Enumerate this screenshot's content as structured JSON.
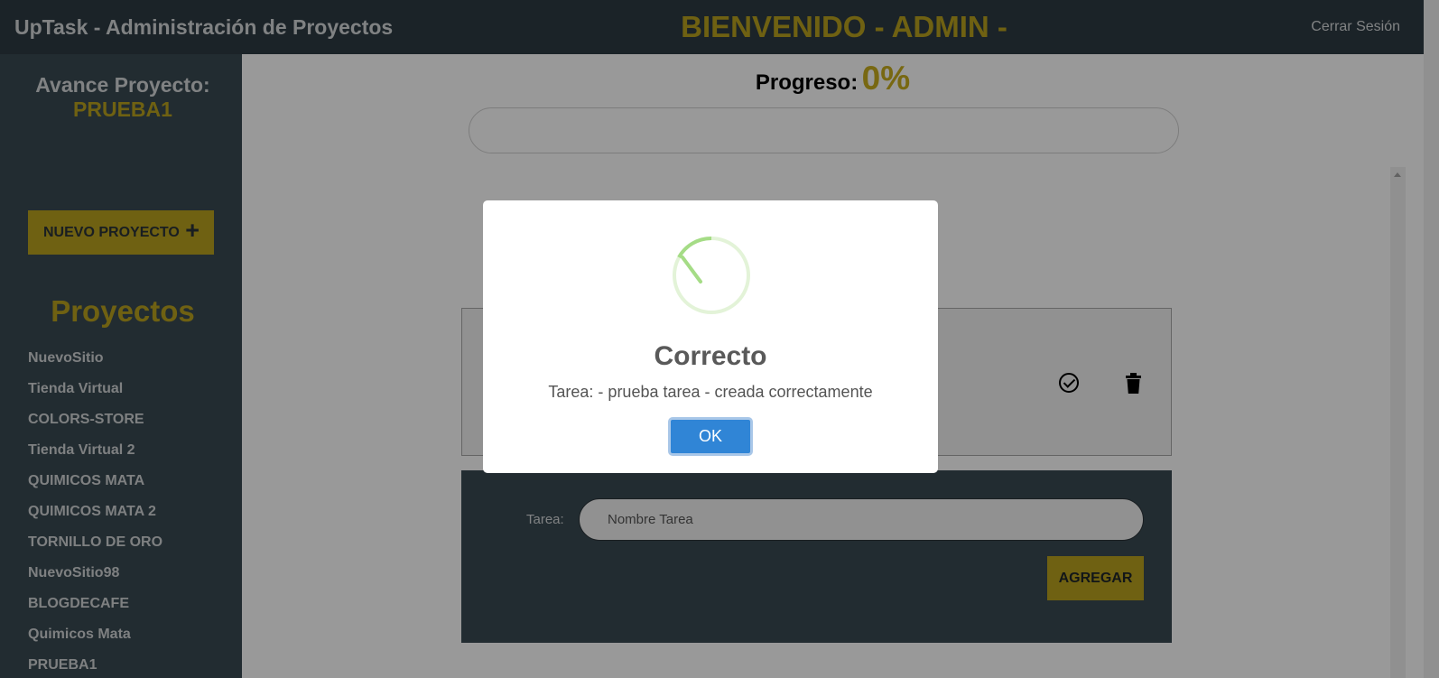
{
  "header": {
    "app_title": "UpTask - Administración de Proyectos",
    "welcome": "BIENVENIDO - ADMIN -",
    "logout": "Cerrar Sesión"
  },
  "sidebar": {
    "heading": "Avance Proyecto:",
    "current_project": "PRUEBA1",
    "new_project_label": "NUEVO PROYECTO",
    "new_project_icon": "+",
    "projects_title": "Proyectos",
    "projects": [
      "NuevoSitio",
      "Tienda Virtual",
      "COLORS-STORE",
      "Tienda Virtual 2",
      "QUIMICOS MATA",
      "QUIMICOS MATA 2",
      "TORNILLO DE ORO",
      "NuevoSitio98",
      "BLOGDECAFE",
      "Quimicos Mata",
      "PRUEBA1"
    ]
  },
  "main": {
    "progress_label": "Progreso:",
    "progress_value": "0%",
    "progress_fraction": 0,
    "task_form": {
      "label": "Tarea:",
      "placeholder": "Nombre Tarea",
      "submit_label": "AGREGAR"
    }
  },
  "modal": {
    "title": "Correcto",
    "text": "Tarea: - prueba tarea - creada correctamente",
    "ok_label": "OK",
    "icon": "success-icon"
  },
  "colors": {
    "topbar": "#2e3b44",
    "sidebar": "#3a4a53",
    "accent": "#b9a21f",
    "ok_button": "#3085d6",
    "success": "#a5dc86"
  }
}
